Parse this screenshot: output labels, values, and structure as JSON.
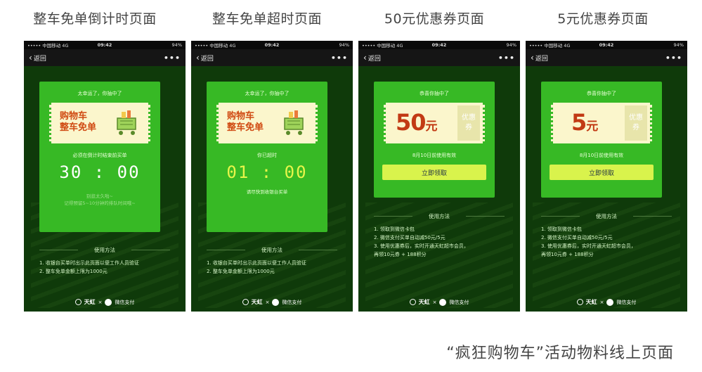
{
  "column_titles": [
    "整车免单倒计时页面",
    "整车免单超时页面",
    "50元优惠券页面",
    "5元优惠券页面"
  ],
  "status_bar": {
    "carrier": "••••• 中国移动  4G",
    "time": "09:42",
    "battery": "94%"
  },
  "navbar": {
    "back_label": "返回",
    "more_label": "•••"
  },
  "phones": [
    {
      "card_title": "太幸运了，你抽中了",
      "ticket_line1": "购物车",
      "ticket_line2": "整车免单",
      "instruction": "必须在倒计时结束前买单",
      "timer": "30 : 00",
      "hint1": "别逛太久啦~",
      "hint2": "记得预留5~10分钟的排队时间哦~"
    },
    {
      "card_title": "太幸运了，你抽中了",
      "ticket_line1": "购物车",
      "ticket_line2": "整车免单",
      "instruction": "你已超时",
      "timer": "01 : 00",
      "hint1": "请尽快到收银台买单"
    },
    {
      "card_title": "恭喜你抽中了",
      "amount": "50",
      "amount_unit": "元",
      "coupon_tag_1": "优惠",
      "coupon_tag_2": "券",
      "valid_until": "8月10日前使用有效",
      "claim_button": "立即领取"
    },
    {
      "card_title": "恭喜你抽中了",
      "amount": "5",
      "amount_unit": "元",
      "coupon_tag_1": "优惠",
      "coupon_tag_2": "券",
      "valid_until": "8月10日前使用有效",
      "claim_button": "立即领取"
    }
  ],
  "usage_title": "使用方法",
  "usage_free": [
    "1. 收银台买单时出示此页面以便工作人员验证",
    "2. 整车免单金额上限为1000元"
  ],
  "usage_coupon_50": [
    "1. 领取到微信卡包",
    "2. 微信支付买单自动减50元/5元",
    "3. 使用优惠券后，实时开通天虹超市会员，",
    "    再领10元券 + 188积分"
  ],
  "usage_coupon_5": [
    "1. 领取到微信卡包",
    "2. 微信支付买单自动减50元/5元",
    "3. 使用优惠券后，实时开通天虹超市会员，",
    "    再领10元券 + 188积分"
  ],
  "footer": {
    "brand": "天虹",
    "cross": "×",
    "pay": "微信支付"
  },
  "bottom_caption": "“疯狂购物车”活动物料线上页面",
  "colors": {
    "bg_dark": "#0f3a0a",
    "card_green": "#37b925",
    "ticket_cream": "#fbf6cc",
    "accent_red": "#c23a14",
    "timer_white": "#ffffff",
    "timer_yellow": "#e6f54a",
    "button_yellow": "#d9f34c"
  }
}
